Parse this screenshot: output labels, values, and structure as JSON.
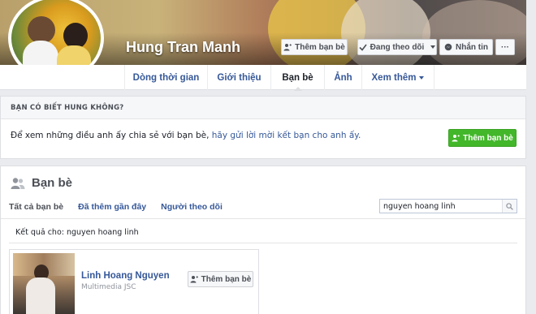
{
  "profile": {
    "name": "Hung Tran Manh"
  },
  "actions": {
    "add_friend": "Thêm bạn bè",
    "following": "Đang theo dõi",
    "message": "Nhắn tin",
    "more": "···"
  },
  "nav": {
    "tabs": [
      "Dòng thời gian",
      "Giới thiệu",
      "Bạn bè",
      "Ảnh",
      "Xem thêm"
    ],
    "active": "Bạn bè"
  },
  "suggest": {
    "heading": "BẠN CÓ BIẾT HUNG KHÔNG?",
    "text_prefix": "Để xem những điều anh ấy chia sẻ với bạn bè, ",
    "link": "hãy gửi lời mời kết bạn cho anh ấy.",
    "button": "Thêm bạn bè"
  },
  "friends": {
    "title": "Bạn bè",
    "tabs": [
      "Tất cả bạn bè",
      "Đã thêm gần đây",
      "Người theo dõi"
    ],
    "search_value": "nguyen hoang linh",
    "results_label": "Kết quả cho: nguyen hoang linh",
    "items": [
      {
        "name": "Linh Hoang Nguyen",
        "subtitle": "Multimedia JSC",
        "button": "Thêm bạn bè"
      }
    ]
  },
  "colors": {
    "link": "#365899",
    "green": "#42b72a",
    "background": "#e9ebee"
  }
}
